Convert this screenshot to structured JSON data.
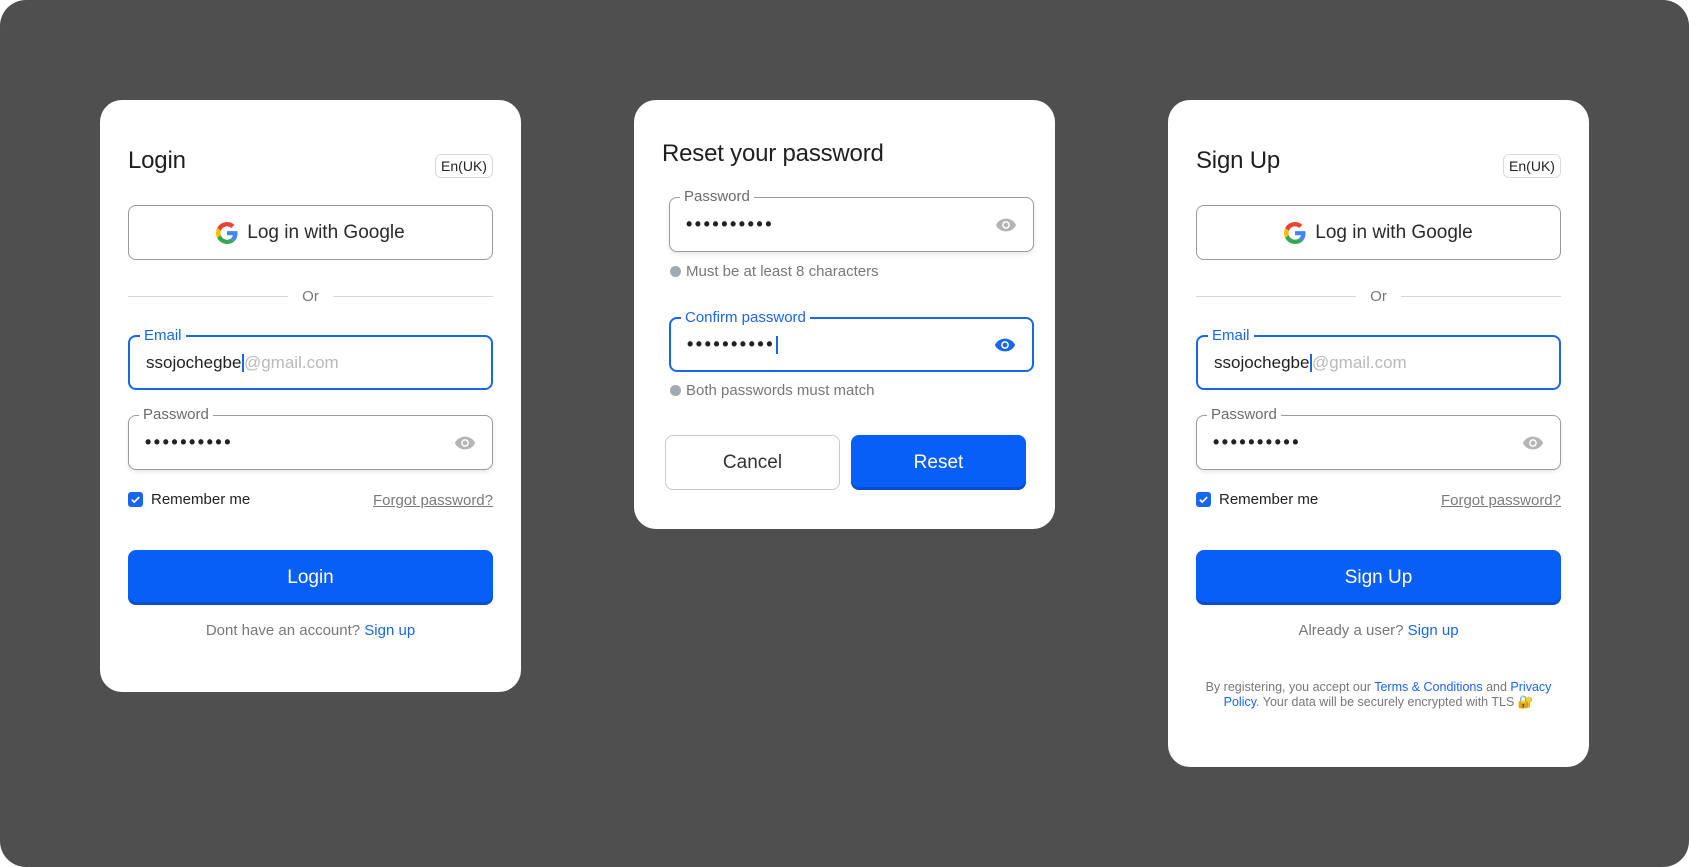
{
  "colors": {
    "background": "#4f4f4f",
    "accent": "#075ff7",
    "focus": "#1a66e8",
    "card": "#ffffff"
  },
  "login": {
    "title": "Login",
    "language": "En(UK)",
    "google_label": "Log in with Google",
    "divider": "Or",
    "email": {
      "label": "Email",
      "typed": "ssojochegbe",
      "suggestion": "@gmail.com"
    },
    "password": {
      "label": "Password",
      "value": "••••••••••"
    },
    "remember_label": "Remember me",
    "remember_checked": true,
    "forgot_label": "Forgot password?",
    "submit_label": "Login",
    "footer_text": "Dont have an account?",
    "footer_link": "Sign up"
  },
  "reset": {
    "title": "Reset your password",
    "password": {
      "label": "Password",
      "value": "••••••••••"
    },
    "password_hint": "Must be at least 8  characters",
    "confirm": {
      "label": "Confirm password",
      "value": "••••••••••"
    },
    "confirm_hint": "Both passwords must match",
    "cancel_label": "Cancel",
    "reset_label": "Reset"
  },
  "signup": {
    "title": "Sign Up",
    "language": "En(UK)",
    "google_label": "Log in with Google",
    "divider": "Or",
    "email": {
      "label": "Email",
      "typed": "ssojochegbe",
      "suggestion": "@gmail.com"
    },
    "password": {
      "label": "Password",
      "value": "••••••••••"
    },
    "remember_label": "Remember me",
    "remember_checked": true,
    "forgot_label": "Forgot password?",
    "submit_label": "Sign Up",
    "footer_text": "Already a user?",
    "footer_link": "Sign up",
    "legal": {
      "prefix": "By registering, you accept our",
      "terms": "Terms & Conditions",
      "and": "and",
      "privacy": "Privacy Policy",
      "suffix": ". Your data will be securely encrypted with TLS",
      "lock": "🔐"
    }
  }
}
